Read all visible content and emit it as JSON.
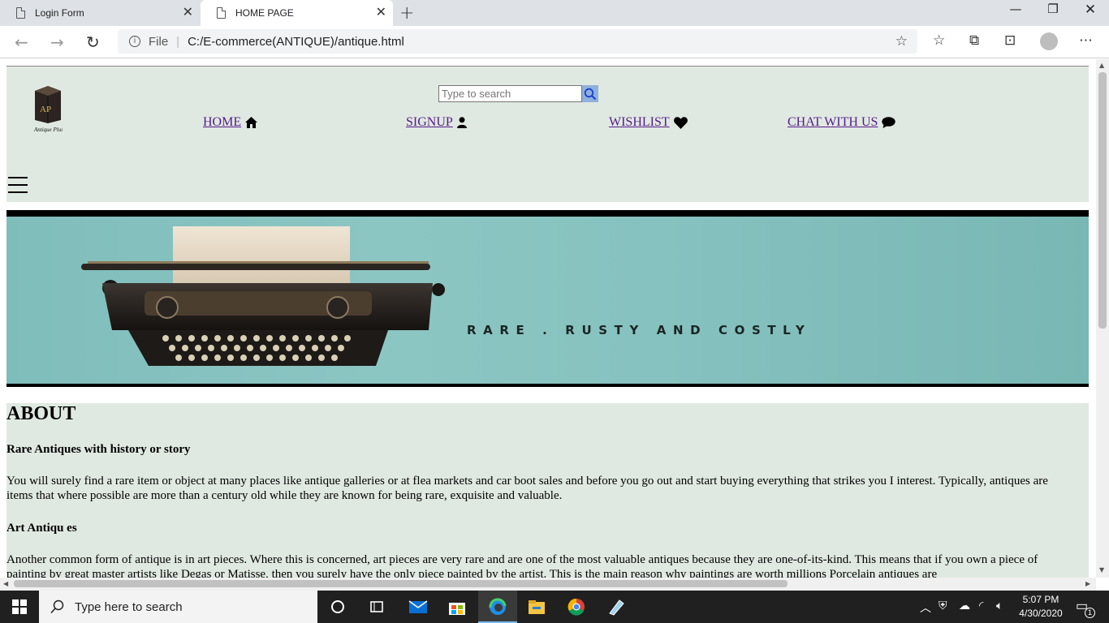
{
  "browser": {
    "tabs": [
      {
        "title": "Login Form",
        "active": false
      },
      {
        "title": "HOME PAGE",
        "active": true
      }
    ],
    "address": {
      "scheme_label": "File",
      "url": "C:/E-commerce(ANTIQUE)/antique.html"
    }
  },
  "page": {
    "logo_text": "Antique Plus",
    "search": {
      "placeholder": "Type to search"
    },
    "nav": [
      {
        "label": "HOME",
        "icon": "home-icon"
      },
      {
        "label": "SIGNUP",
        "icon": "user-icon"
      },
      {
        "label": "WISHLIST",
        "icon": "heart-icon"
      },
      {
        "label": "CHAT WITH US",
        "icon": "chat-bubble-icon"
      }
    ],
    "banner": {
      "tagline": "RARE . RUSTY AND COSTLY"
    },
    "about": {
      "heading": "ABOUT",
      "sections": [
        {
          "title": "Rare Antiques with history or story",
          "text": "You will surely find a rare item or object at many places like antique galleries or at flea markets and car boot sales and before you go out and start buying everything that strikes you I interest. Typically, antiques are items that where possible are more than a century old while they are known for being rare, exquisite and valuable."
        },
        {
          "title": "Art Antiqu es",
          "text": "Another common form of antique is in art pieces. Where this is concerned, art pieces are very rare and are one of the most valuable antiques because they are one-of-its-kind. This means that if you own a piece of painting by great master artists like Degas or Matisse, then you surely have the only piece painted by the artist. This is the main reason why paintings are worth millions Porcelain antiques are"
        }
      ]
    }
  },
  "taskbar": {
    "search_placeholder": "Type here to search",
    "time": "5:07 PM",
    "date": "4/30/2020",
    "notification_count": "1"
  }
}
